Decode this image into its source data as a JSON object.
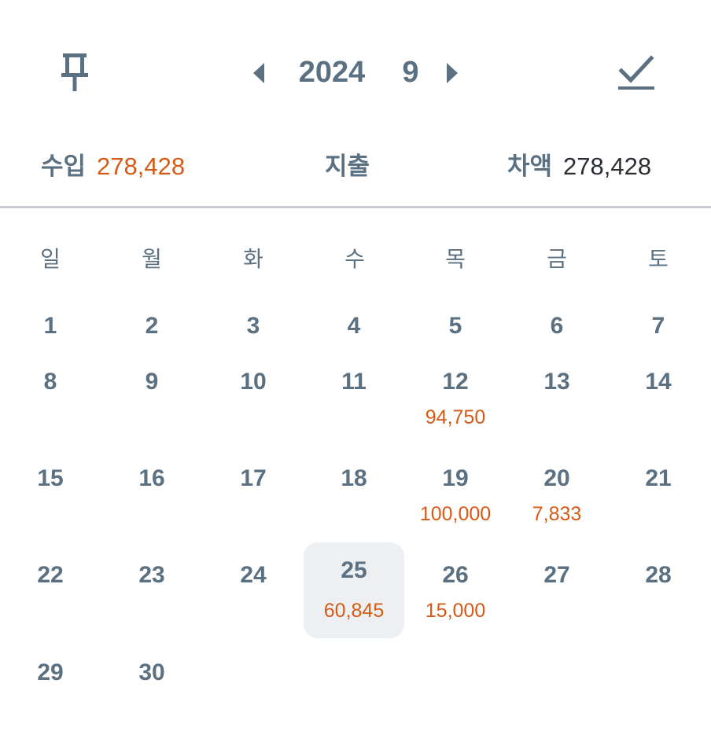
{
  "header": {
    "pin_icon": "pin-icon",
    "prev_icon": "caret-left-icon",
    "next_icon": "caret-right-icon",
    "check_icon": "check-icon",
    "year": "2024",
    "month": "9"
  },
  "summary": {
    "income_label": "수입",
    "income_value": "278,428",
    "expense_label": "지출",
    "expense_value": "",
    "diff_label": "차액",
    "diff_value": "278,428"
  },
  "colors": {
    "accent": "#d65a16",
    "text": "#5b7080",
    "selected_bg": "#ecf0f3"
  },
  "weekdays": [
    "일",
    "월",
    "화",
    "수",
    "목",
    "금",
    "토"
  ],
  "calendar": {
    "start_weekday": 0,
    "selected_day": "25",
    "days": [
      {
        "day": "1",
        "amount": ""
      },
      {
        "day": "2",
        "amount": ""
      },
      {
        "day": "3",
        "amount": ""
      },
      {
        "day": "4",
        "amount": ""
      },
      {
        "day": "5",
        "amount": ""
      },
      {
        "day": "6",
        "amount": ""
      },
      {
        "day": "7",
        "amount": ""
      },
      {
        "day": "8",
        "amount": ""
      },
      {
        "day": "9",
        "amount": ""
      },
      {
        "day": "10",
        "amount": ""
      },
      {
        "day": "11",
        "amount": ""
      },
      {
        "day": "12",
        "amount": "94,750"
      },
      {
        "day": "13",
        "amount": ""
      },
      {
        "day": "14",
        "amount": ""
      },
      {
        "day": "15",
        "amount": ""
      },
      {
        "day": "16",
        "amount": ""
      },
      {
        "day": "17",
        "amount": ""
      },
      {
        "day": "18",
        "amount": ""
      },
      {
        "day": "19",
        "amount": "100,000"
      },
      {
        "day": "20",
        "amount": "7,833"
      },
      {
        "day": "21",
        "amount": ""
      },
      {
        "day": "22",
        "amount": ""
      },
      {
        "day": "23",
        "amount": ""
      },
      {
        "day": "24",
        "amount": ""
      },
      {
        "day": "25",
        "amount": "60,845"
      },
      {
        "day": "26",
        "amount": "15,000"
      },
      {
        "day": "27",
        "amount": ""
      },
      {
        "day": "28",
        "amount": ""
      },
      {
        "day": "29",
        "amount": ""
      },
      {
        "day": "30",
        "amount": ""
      }
    ]
  }
}
